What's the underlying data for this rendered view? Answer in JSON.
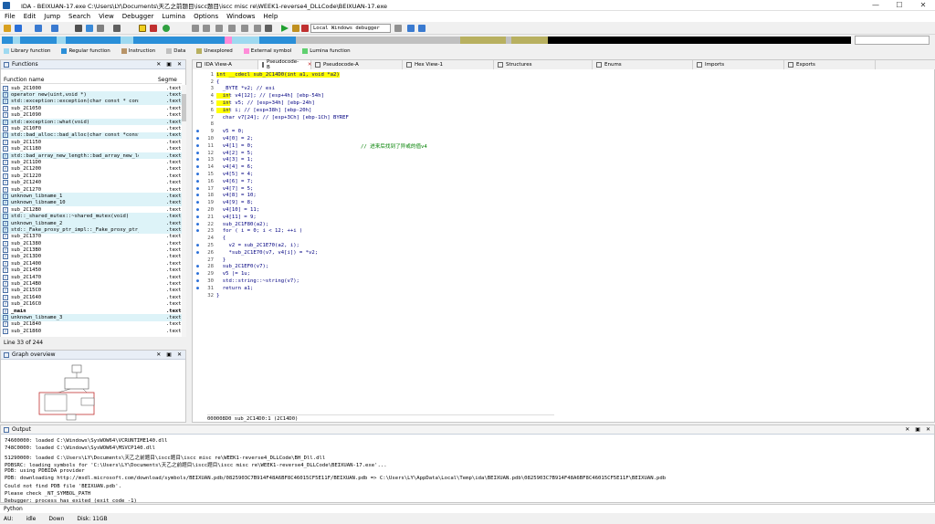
{
  "titlebar": {
    "title": "IDA - BEIXUAN-17.exe C:\\Users\\LY\\Documents\\天乙之前题目\\iscc题目\\iscc misc re\\WEEK1-reverse4_DLLCode\\BEIXUAN-17.exe",
    "minimize": "—",
    "maximize": "☐",
    "close": "✕"
  },
  "menu": [
    "File",
    "Edit",
    "Jump",
    "Search",
    "View",
    "Debugger",
    "Lumina",
    "Options",
    "Windows",
    "Help"
  ],
  "toolbar": {
    "debugger": "Local Windows debugger"
  },
  "legend": [
    {
      "label": "Library function",
      "color": "#9ed9f0"
    },
    {
      "label": "Regular function",
      "color": "#2a8fd8"
    },
    {
      "label": "Instruction",
      "color": "#b89468"
    },
    {
      "label": "Data",
      "color": "#c0c0c0"
    },
    {
      "label": "Unexplored",
      "color": "#b8b060"
    },
    {
      "label": "External symbol",
      "color": "#ff8cd8"
    },
    {
      "label": "Lumina function",
      "color": "#60d070"
    }
  ],
  "functions": {
    "title": "Functions",
    "col_name": "Function name",
    "col_seg": "Segme",
    "rows": [
      {
        "name": "sub_2C1000",
        "seg": ".text",
        "lib": false
      },
      {
        "name": "operator new(uint,void *)",
        "seg": ".text",
        "lib": true
      },
      {
        "name": "std::exception::exception(char const * const,i···",
        "seg": ".text",
        "lib": true
      },
      {
        "name": "sub_2C1050",
        "seg": ".text",
        "lib": false
      },
      {
        "name": "sub_2C1090",
        "seg": ".text",
        "lib": false
      },
      {
        "name": "std::exception::what(void)",
        "seg": ".text",
        "lib": true
      },
      {
        "name": "sub_2C10F0",
        "seg": ".text",
        "lib": false
      },
      {
        "name": "std::bad_alloc::bad_alloc(char const *const)",
        "seg": ".text",
        "lib": true
      },
      {
        "name": "sub_2C1150",
        "seg": ".text",
        "lib": false
      },
      {
        "name": "sub_2C1180",
        "seg": ".text",
        "lib": false
      },
      {
        "name": "std::bad_array_new_length::bad_array_new_lengt···",
        "seg": ".text",
        "lib": true
      },
      {
        "name": "sub_2C11D0",
        "seg": ".text",
        "lib": false
      },
      {
        "name": "sub_2C1200",
        "seg": ".text",
        "lib": false
      },
      {
        "name": "sub_2C1220",
        "seg": ".text",
        "lib": false
      },
      {
        "name": "sub_2C1240",
        "seg": ".text",
        "lib": false
      },
      {
        "name": "sub_2C1270",
        "seg": ".text",
        "lib": false
      },
      {
        "name": "unknown_libname_1",
        "seg": ".text",
        "lib": true
      },
      {
        "name": "unknown_libname_10",
        "seg": ".text",
        "lib": true
      },
      {
        "name": "sub_2C12B0",
        "seg": ".text",
        "lib": false
      },
      {
        "name": "std::_shared_mutex::~shared_mutex(void)",
        "seg": ".text",
        "lib": true
      },
      {
        "name": "unknown_libname_2",
        "seg": ".text",
        "lib": true
      },
      {
        "name": "std::_Fake_proxy_ptr_impl::_Fake_proxy_ptr_imp···",
        "seg": ".text",
        "lib": true
      },
      {
        "name": "sub_2C1370",
        "seg": ".text",
        "lib": false
      },
      {
        "name": "sub_2C1380",
        "seg": ".text",
        "lib": false
      },
      {
        "name": "sub_2C13B0",
        "seg": ".text",
        "lib": false
      },
      {
        "name": "sub_2C13D0",
        "seg": ".text",
        "lib": false
      },
      {
        "name": "sub_2C1400",
        "seg": ".text",
        "lib": false
      },
      {
        "name": "sub_2C1450",
        "seg": ".text",
        "lib": false
      },
      {
        "name": "sub_2C1470",
        "seg": ".text",
        "lib": false
      },
      {
        "name": "sub_2C14B0",
        "seg": ".text",
        "lib": false
      },
      {
        "name": "sub_2C15C0",
        "seg": ".text",
        "lib": false
      },
      {
        "name": "sub_2C1640",
        "seg": ".text",
        "lib": false
      },
      {
        "name": "sub_2C16C0",
        "seg": ".text",
        "lib": false
      },
      {
        "name": "_main",
        "seg": ".text",
        "lib": false,
        "sel": true
      },
      {
        "name": "unknown_libname_3",
        "seg": ".text",
        "lib": true
      },
      {
        "name": "sub_2C1840",
        "seg": ".text",
        "lib": false
      },
      {
        "name": "sub_2C1860",
        "seg": ".text",
        "lib": false
      }
    ]
  },
  "line_info": "Line 33 of 244",
  "graph": {
    "title": "Graph overview"
  },
  "tabs": [
    {
      "label": "IDA View-A",
      "active": false,
      "close": false
    },
    {
      "label": "Pseudocode-B",
      "active": true,
      "close": true
    },
    {
      "label": "Pseudocode-A",
      "active": false,
      "close": false
    },
    {
      "label": "Hex View-1",
      "active": false,
      "close": false
    },
    {
      "label": "Structures",
      "active": false,
      "close": false
    },
    {
      "label": "Enums",
      "active": false,
      "close": false
    },
    {
      "label": "Imports",
      "active": false,
      "close": false
    },
    {
      "label": "Exports",
      "active": false,
      "close": false
    }
  ],
  "code": [
    {
      "n": "1",
      "dot": false,
      "t": "int __cdecl sub_2C14D0(int a1, void *a2)",
      "hl": true
    },
    {
      "n": "2",
      "dot": false,
      "t": "{"
    },
    {
      "n": "3",
      "dot": false,
      "t": "  _BYTE *v2; // esi",
      "cm": true
    },
    {
      "n": "4",
      "dot": false,
      "t": "  int v4[12]; // [esp+4h] [ebp-54h]",
      "hlk": true
    },
    {
      "n": "5",
      "dot": false,
      "t": "  int v5; // [esp+34h] [ebp-24h]",
      "hlk": true
    },
    {
      "n": "6",
      "dot": false,
      "t": "  int i; // [esp+38h] [ebp-20h]",
      "hlk": true
    },
    {
      "n": "7",
      "dot": false,
      "t": "  char v7[24]; // [esp+3Ch] [ebp-1Ch] BYREF",
      "cm": true
    },
    {
      "n": "8",
      "dot": false,
      "t": ""
    },
    {
      "n": "9",
      "dot": true,
      "t": "  v5 = 0;"
    },
    {
      "n": "10",
      "dot": true,
      "t": "  v4[0] = 2;"
    },
    {
      "n": "11",
      "dot": true,
      "t": "  v4[1] = 0;",
      "note": "// 进来后找到了异或的值v4"
    },
    {
      "n": "12",
      "dot": true,
      "t": "  v4[2] = 5;"
    },
    {
      "n": "13",
      "dot": true,
      "t": "  v4[3] = 1;"
    },
    {
      "n": "14",
      "dot": true,
      "t": "  v4[4] = 6;"
    },
    {
      "n": "15",
      "dot": true,
      "t": "  v4[5] = 4;"
    },
    {
      "n": "16",
      "dot": true,
      "t": "  v4[6] = 7;"
    },
    {
      "n": "17",
      "dot": true,
      "t": "  v4[7] = 5;"
    },
    {
      "n": "18",
      "dot": true,
      "t": "  v4[8] = 10;"
    },
    {
      "n": "19",
      "dot": true,
      "t": "  v4[9] = 8;"
    },
    {
      "n": "20",
      "dot": true,
      "t": "  v4[10] = 11;"
    },
    {
      "n": "21",
      "dot": true,
      "t": "  v4[11] = 9;"
    },
    {
      "n": "22",
      "dot": true,
      "t": "  sub_2C1F80(a2);"
    },
    {
      "n": "23",
      "dot": true,
      "t": "  for ( i = 0; i < 12; ++i )"
    },
    {
      "n": "24",
      "dot": false,
      "t": "  {"
    },
    {
      "n": "25",
      "dot": true,
      "t": "    v2 = sub_2C1E70(a2, i);"
    },
    {
      "n": "26",
      "dot": true,
      "t": "    *sub_2C1E70(v7, v4[i]) = *v2;"
    },
    {
      "n": "27",
      "dot": false,
      "t": "  }"
    },
    {
      "n": "28",
      "dot": true,
      "t": "  sub_2C1EF0(v7);"
    },
    {
      "n": "29",
      "dot": true,
      "t": "  v5 |= 1u;"
    },
    {
      "n": "30",
      "dot": true,
      "t": "  std::string::~string(v7);"
    },
    {
      "n": "31",
      "dot": true,
      "t": "  return a1;"
    },
    {
      "n": "32",
      "dot": false,
      "t": "}"
    }
  ],
  "codebar": "000008D0 sub_2C14D0:1 (2C14D0)",
  "output": {
    "title": "Output",
    "lines": [
      "74600000: loaded C:\\Windows\\SysWOW64\\VCRUNTIME140.dll",
      "748C0000: loaded C:\\Windows\\SysWOW64\\MSVCP140.dll",
      "51290000: loaded C:\\Users\\LY\\Documents\\天乙之前题目\\iscc题目\\iscc misc re\\WEEK1-reverse4_DLLCode\\BH_Dll.dll",
      "PDBSRC: loading symbols for 'C:\\Users\\LY\\Documents\\天乙之前题目\\iscc题目\\iscc misc re\\WEEK1-reverse4_DLLCode\\BEIXUAN-17.exe'...",
      "PDB: using PDBIDA provider",
      "PDB: downloading http://msdl.microsoft.com/download/symbols/BEIXUAN.pdb/0825903C7B914F48A6BF8C46015CF5E11F/BEIXUAN.pdb => C:\\Users\\LY\\AppData\\Local\\Temp\\ida\\BEIXUAN.pdb\\0825903C7B914F48A6BF8C46015CF5E11F\\BEIXUAN.pdb",
      "Could not find PDB file 'BEIXUAN.pdb'.",
      "Please check _NT_SYMBOL_PATH",
      "Debugger: process has exited (exit code -1)"
    ]
  },
  "python_label": "Python",
  "status": {
    "au": "AU:",
    "state": "idle",
    "dir": "Down",
    "disk": "Disk: 11GB"
  }
}
